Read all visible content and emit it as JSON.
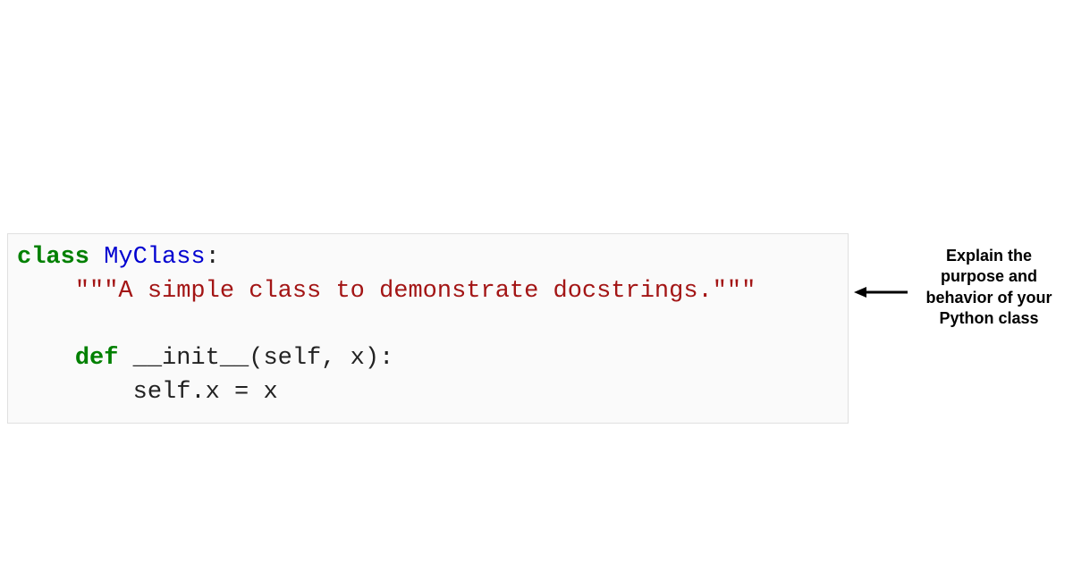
{
  "code": {
    "line1": {
      "kw": "class",
      "sp": " ",
      "name": "MyClass",
      "colon": ":"
    },
    "line2": {
      "indent": "    ",
      "doc": "\"\"\"A simple class to demonstrate docstrings.\"\"\""
    },
    "line3": "",
    "line4": {
      "indent": "    ",
      "kw": "def",
      "sp": " ",
      "fn": "__init__",
      "params": "(self, x):"
    },
    "line5": {
      "indent": "        ",
      "body": "self.x = x"
    }
  },
  "annotation": {
    "text": "Explain the purpose and behavior of your Python class"
  }
}
